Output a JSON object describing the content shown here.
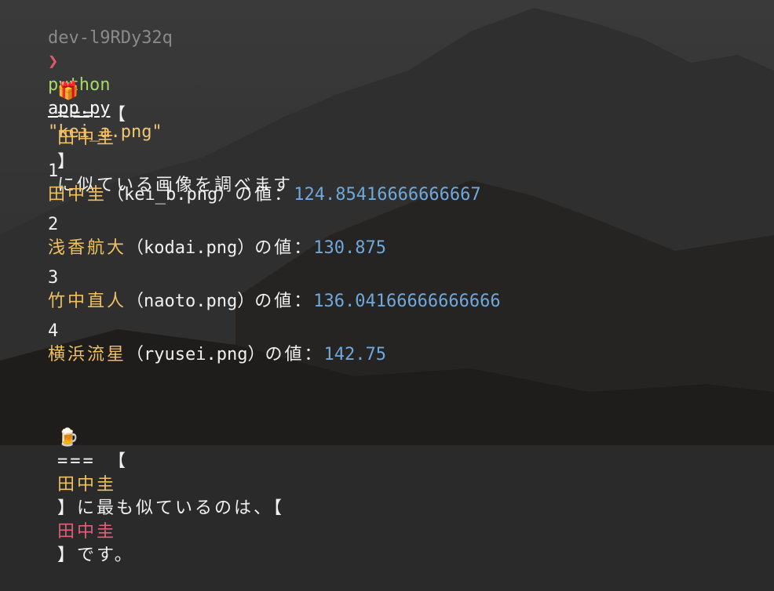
{
  "prompt": {
    "host": "dev-l9RDy32q",
    "arrow": "❯",
    "command": "python",
    "script": "app.py",
    "argument": "\"kei_a.png\""
  },
  "header": {
    "icon": "gift-icon",
    "icon_glyph": "🎁",
    "prefix": "=== 【",
    "name": "田中圭",
    "suffix": "】",
    "message": "に似ている画像を調べます"
  },
  "results": [
    {
      "rank": "1",
      "name": "田中圭",
      "file": "（kei_b.png）",
      "label": "の値：",
      "value": "124.85416666666667"
    },
    {
      "rank": "2",
      "name": "浅香航大",
      "file": "（kodai.png）",
      "label": "の値：",
      "value": "130.875"
    },
    {
      "rank": "3",
      "name": "竹中直人",
      "file": "（naoto.png）",
      "label": "の値：",
      "value": "136.04166666666666"
    },
    {
      "rank": "4",
      "name": "横浜流星",
      "file": "（ryusei.png）",
      "label": "の値：",
      "value": "142.75"
    }
  ],
  "footer": {
    "icon": "beer-icon",
    "icon_glyph": "🍺",
    "prefix": "=== 【",
    "name": "田中圭",
    "mid": "】に最も似ているのは、【",
    "match": "田中圭",
    "suffix": "】です。"
  },
  "colors": {
    "name": "#f0c060",
    "value": "#6fa8dc",
    "match": "#e0607a",
    "command": "#a6d96a"
  }
}
